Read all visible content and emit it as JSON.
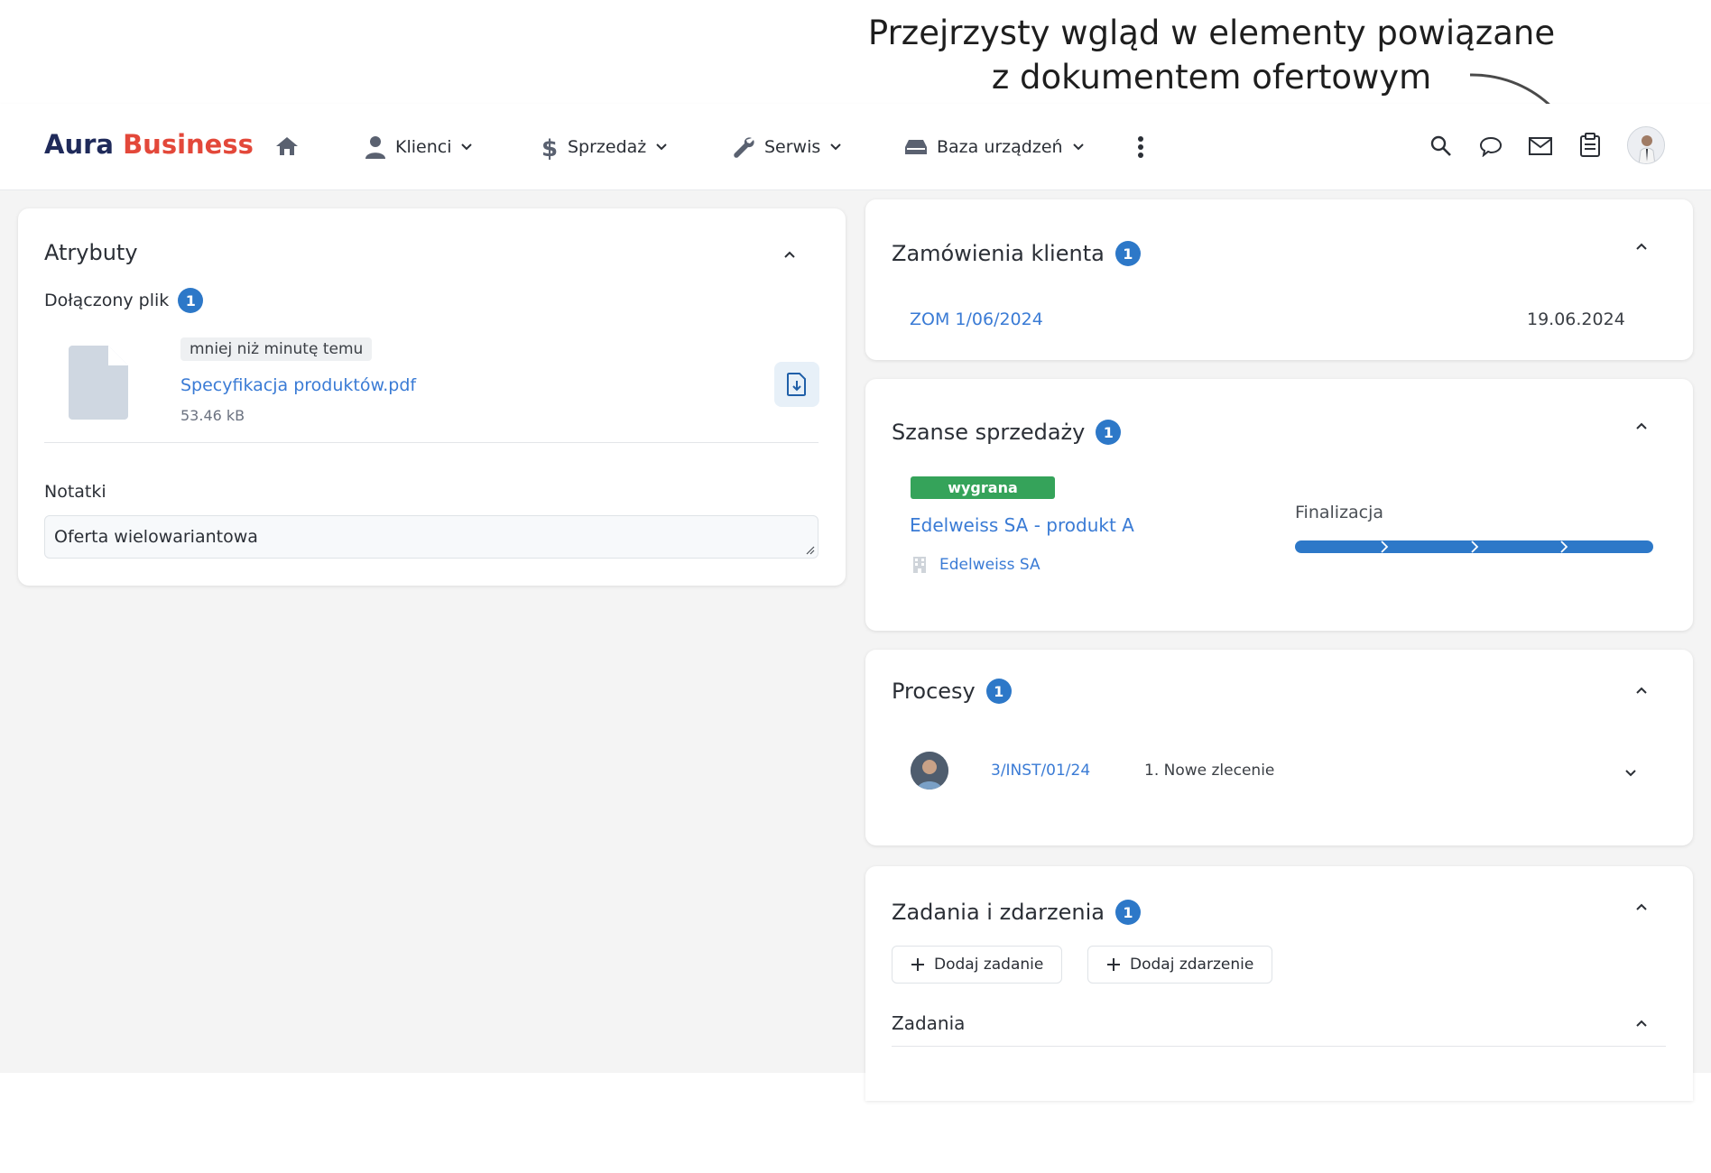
{
  "caption": {
    "line1": "Przejrzysty wgląd w elementy powiązane",
    "line2": "z dokumentem ofertowym"
  },
  "navbar": {
    "logo_part1": "Aura",
    "logo_part2": "Business",
    "menu": [
      {
        "label": "Klienci",
        "icon": "user-icon"
      },
      {
        "label": "Sprzedaż",
        "icon": "dollar-icon"
      },
      {
        "label": "Serwis",
        "icon": "wrench-icon"
      },
      {
        "label": "Baza urządzeń",
        "icon": "device-icon"
      }
    ],
    "icons": [
      "home-icon",
      "more-icon",
      "search-icon",
      "chat-icon",
      "mail-icon",
      "clipboard-icon",
      "avatar"
    ]
  },
  "attributes_card": {
    "title": "Atrybuty",
    "attached_label": "Dołączony plik",
    "attached_count": "1",
    "file": {
      "time": "mniej niż minutę temu",
      "name": "Specyfikacja produktów.pdf",
      "size": "53.46 kB"
    },
    "notes_label": "Notatki",
    "notes_value": "Oferta wielowariantowa"
  },
  "orders_card": {
    "title": "Zamówienia klienta",
    "count": "1",
    "order_number": "ZOM 1/06/2024",
    "order_date": "19.06.2024"
  },
  "opportunities_card": {
    "title": "Szanse sprzedaży",
    "count": "1",
    "status": "wygrana",
    "status_color": "#35a35a",
    "name": "Edelweiss SA - produkt A",
    "company": "Edelweiss SA",
    "stage": "Finalizacja",
    "progress_steps_completed": 4,
    "progress_steps_total": 4
  },
  "processes_card": {
    "title": "Procesy",
    "count": "1",
    "number": "3/INST/01/24",
    "step": "1. Nowe zlecenie"
  },
  "tasks_card": {
    "title": "Zadania i zdarzenia",
    "count": "1",
    "add_task": "Dodaj zadanie",
    "add_event": "Dodaj zdarzenie",
    "tasks_section": "Zadania"
  },
  "colors": {
    "accent": "#2d78c8",
    "link": "#3a7bd5",
    "brand_dark": "#1f2a5a",
    "brand_red": "#e3483a"
  }
}
